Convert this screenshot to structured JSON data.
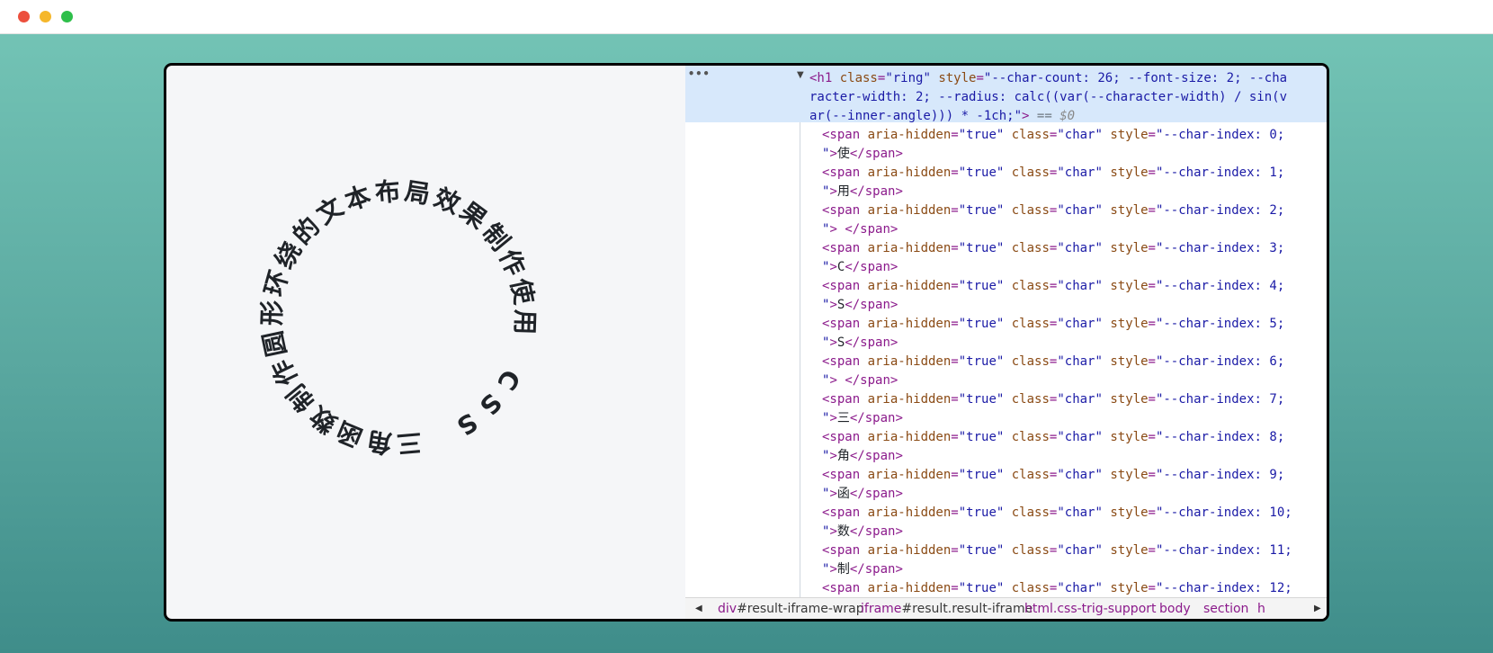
{
  "window": {
    "controls": [
      "close",
      "minimize",
      "maximize"
    ]
  },
  "preview": {
    "ring_chars": [
      "使",
      "用",
      " ",
      "C",
      "S",
      "S",
      " ",
      "三",
      "角",
      "函",
      "数",
      "制",
      "作",
      "圆",
      "形",
      "环",
      "绕",
      "的",
      "文",
      "本",
      "布",
      "局",
      "效",
      "果",
      "制",
      "作"
    ]
  },
  "devtools": {
    "ellipsis": "•••",
    "h1_lines": [
      "<h1 class=\"ring\" style=\"--char-count: 26; --font-size: 2; --cha",
      "racter-width: 2; --radius: calc((var(--character-width) / sin(v",
      "ar(--inner-angle))) * -1ch;\"> == $0"
    ],
    "span_rows": [
      {
        "index": "0",
        "char": "使"
      },
      {
        "index": "1",
        "char": "用"
      },
      {
        "index": "2",
        "char": " "
      },
      {
        "index": "3",
        "char": "C"
      },
      {
        "index": "4",
        "char": "S"
      },
      {
        "index": "5",
        "char": "S"
      },
      {
        "index": "6",
        "char": " "
      },
      {
        "index": "7",
        "char": "三"
      },
      {
        "index": "8",
        "char": "角"
      },
      {
        "index": "9",
        "char": "函"
      },
      {
        "index": "10",
        "char": "数"
      },
      {
        "index": "11",
        "char": "制"
      },
      {
        "index": "12",
        "char": ""
      }
    ],
    "breadcrumbs": [
      {
        "tag": "div",
        "rest": "#result-iframe-wrap"
      },
      {
        "tag": "iframe",
        "rest": "#result.result-iframe"
      },
      {
        "tag": "html.css-trig-support",
        "rest": ""
      },
      {
        "tag": "body",
        "rest": ""
      },
      {
        "tag": "section",
        "rest": ""
      },
      {
        "tag": "h",
        "rest": ""
      }
    ]
  }
}
